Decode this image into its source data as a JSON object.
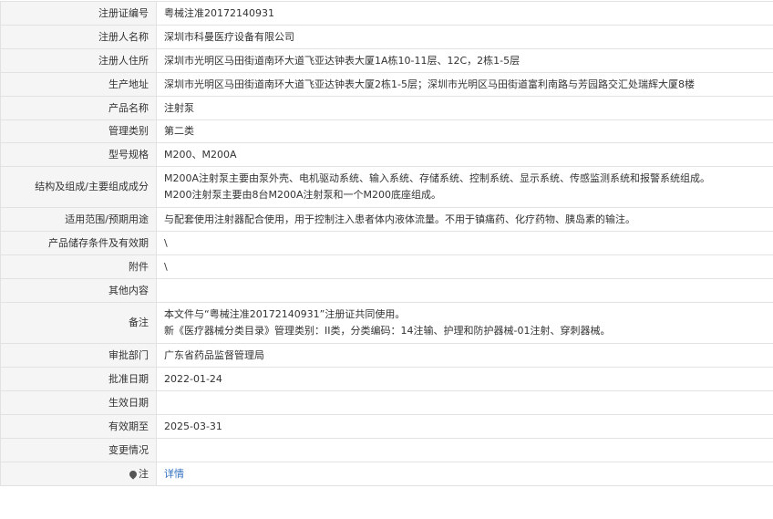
{
  "rows": [
    {
      "label": "注册证编号",
      "value": "粤械注准20172140931"
    },
    {
      "label": "注册人名称",
      "value": "深圳市科曼医疗设备有限公司"
    },
    {
      "label": "注册人住所",
      "value": "深圳市光明区马田街道南环大道飞亚达钟表大厦1A栋10-11层、12C，2栋1-5层"
    },
    {
      "label": "生产地址",
      "value": "深圳市光明区马田街道南环大道飞亚达钟表大厦2栋1-5层；深圳市光明区马田街道富利南路与芳园路交汇处瑞辉大厦8楼"
    },
    {
      "label": "产品名称",
      "value": "注射泵"
    },
    {
      "label": "管理类别",
      "value": "第二类"
    },
    {
      "label": "型号规格",
      "value": "M200、M200A"
    },
    {
      "label": "结构及组成/主要组成成分",
      "lines": [
        "M200A注射泵主要由泵外壳、电机驱动系统、输入系统、存储系统、控制系统、显示系统、传感监测系统和报警系统组成。",
        "M200注射泵主要由8台M200A注射泵和一个M200底座组成。"
      ]
    },
    {
      "label": "适用范围/预期用途",
      "value": "与配套使用注射器配合使用，用于控制注入患者体内液体流量。不用于镇痛药、化疗药物、胰岛素的输注。"
    },
    {
      "label": "产品储存条件及有效期",
      "value": "\\"
    },
    {
      "label": "附件",
      "value": "\\"
    },
    {
      "label": "其他内容",
      "value": ""
    },
    {
      "label": "备注",
      "lines": [
        "本文件与“粤械注准20172140931”注册证共同使用。",
        "新《医疗器械分类目录》管理类别：II类，分类编码：14注输、护理和防护器械-01注射、穿刺器械。"
      ]
    },
    {
      "label": "审批部门",
      "value": "广东省药品监督管理局"
    },
    {
      "label": "批准日期",
      "value": "2022-01-24"
    },
    {
      "label": "生效日期",
      "value": ""
    },
    {
      "label": "有效期至",
      "value": "2025-03-31"
    },
    {
      "label": "变更情况",
      "value": ""
    }
  ],
  "note_row": {
    "label": "注",
    "link": "详情"
  },
  "colors": {
    "label_bg": "#f5f5f5",
    "border": "#e2e2e2",
    "link": "#2f6fbf"
  }
}
